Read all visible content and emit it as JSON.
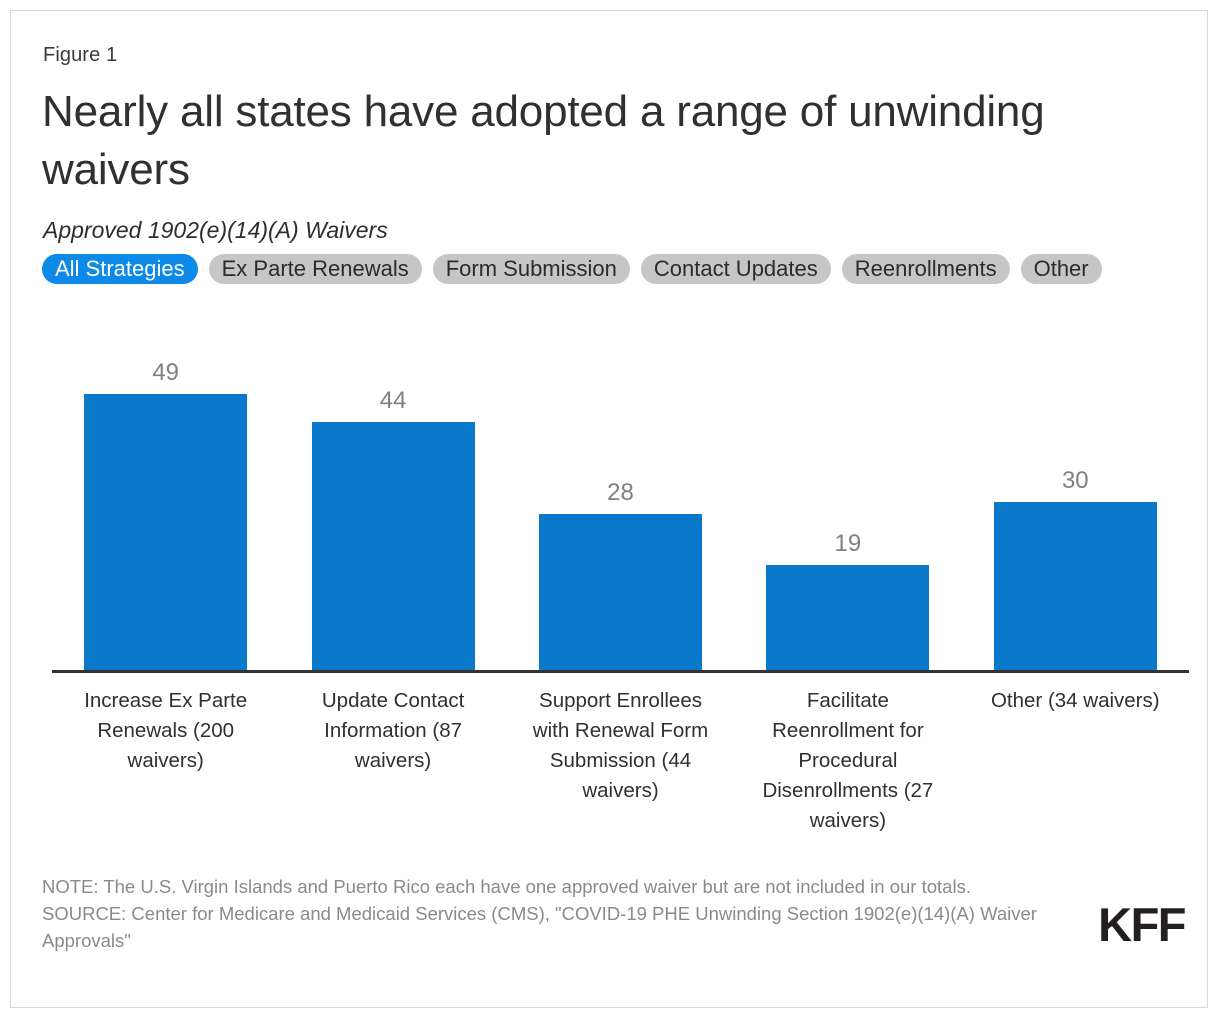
{
  "header": {
    "figure_number": "Figure 1",
    "title": "Nearly all states have adopted a range of unwinding waivers",
    "subtitle": "Approved 1902(e)(14)(A) Waivers"
  },
  "pills": [
    {
      "label": "All Strategies",
      "active": true
    },
    {
      "label": "Ex Parte Renewals",
      "active": false
    },
    {
      "label": "Form Submission",
      "active": false
    },
    {
      "label": "Contact Updates",
      "active": false
    },
    {
      "label": "Reenrollments",
      "active": false
    },
    {
      "label": "Other",
      "active": false
    }
  ],
  "colors": {
    "bar": "#0b79c9",
    "pill_active": "#0d8ae8",
    "pill_inactive": "#c6c6c6",
    "value_label": "#808080",
    "axis": "#333333",
    "frame_border": "#d8d8d8"
  },
  "footer": {
    "note": "NOTE: The U.S. Virgin Islands and Puerto Rico each have one approved waiver but are not included in our totals.",
    "source": "SOURCE: Center for Medicare and Medicaid Services (CMS), \"COVID-19 PHE Unwinding Section 1902(e)(14)(A) Waiver Approvals\"",
    "logo": "KFF"
  },
  "chart_data": {
    "type": "bar",
    "title": "Nearly all states have adopted a range of unwinding waivers",
    "subtitle": "Approved 1902(e)(14)(A) Waivers",
    "xlabel": "",
    "ylabel": "",
    "ylim": [
      0,
      49
    ],
    "grid": false,
    "legend": "none",
    "orientation": "vertical",
    "categories": [
      "Increase Ex Parte Renewals (200 waivers)",
      "Update Contact Information (87 waivers)",
      "Support Enrollees with Renewal Form Submission (44 waivers)",
      "Facilitate Reenrollment for Procedural Disenrollments (27 waivers)",
      "Other (34 waivers)"
    ],
    "values": [
      49,
      44,
      28,
      19,
      30
    ],
    "value_labels": [
      "49",
      "44",
      "28",
      "19",
      "30"
    ],
    "series": [
      {
        "name": "All Strategies",
        "values": [
          49,
          44,
          28,
          19,
          30
        ]
      }
    ]
  }
}
